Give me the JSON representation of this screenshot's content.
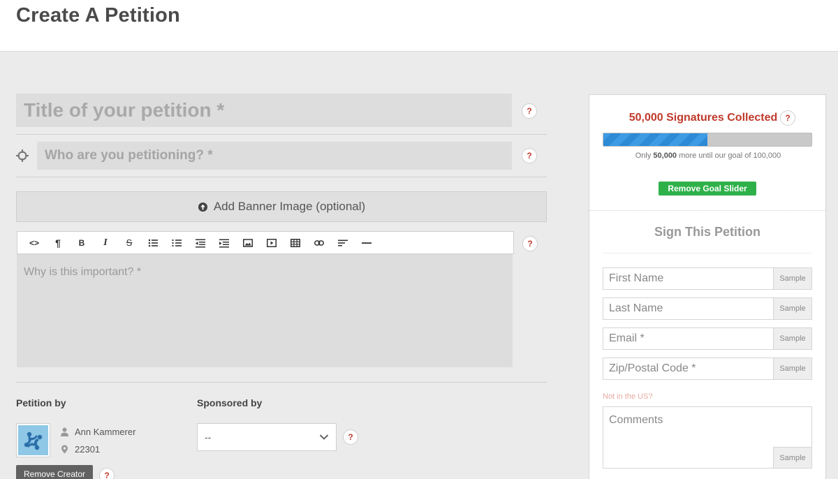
{
  "header": {
    "title": "Create A Petition"
  },
  "help_mark": "?",
  "petition": {
    "title_placeholder": "Title of your petition *",
    "target_placeholder": "Who are you petitioning? *",
    "banner_label": "Add Banner Image (optional)",
    "body_placeholder": "Why is this important? *"
  },
  "editor_toolbar": {
    "buttons": [
      {
        "name": "html-icon",
        "glyph": "<>"
      },
      {
        "name": "paragraph-icon",
        "glyph": "¶"
      },
      {
        "name": "bold-icon",
        "glyph": "B"
      },
      {
        "name": "italic-icon",
        "glyph": "I"
      },
      {
        "name": "strikethrough-icon",
        "glyph": "S"
      },
      {
        "name": "unordered-list-icon",
        "glyph": ""
      },
      {
        "name": "ordered-list-icon",
        "glyph": ""
      },
      {
        "name": "outdent-icon",
        "glyph": ""
      },
      {
        "name": "indent-icon",
        "glyph": ""
      },
      {
        "name": "image-icon",
        "glyph": ""
      },
      {
        "name": "video-icon",
        "glyph": ""
      },
      {
        "name": "table-icon",
        "glyph": ""
      },
      {
        "name": "link-icon",
        "glyph": ""
      },
      {
        "name": "align-left-icon",
        "glyph": ""
      },
      {
        "name": "horizontal-rule-icon",
        "glyph": ""
      }
    ]
  },
  "creator": {
    "label": "Petition by",
    "name": "Ann Kammerer",
    "zip": "22301",
    "remove_label": "Remove Creator"
  },
  "sponsor": {
    "label": "Sponsored by",
    "selected": "--"
  },
  "goal": {
    "collected_label": "50,000 Signatures Collected",
    "progress_fraction": 0.5,
    "note_prefix": "Only ",
    "note_count": "50,000",
    "note_suffix": " more until our goal of 100,000",
    "remove_label": "Remove Goal Slider"
  },
  "sign_form": {
    "title": "Sign This Petition",
    "sample_label": "Sample",
    "first_name_placeholder": "First Name",
    "last_name_placeholder": "Last Name",
    "email_placeholder": "Email *",
    "zip_placeholder": "Zip/Postal Code *",
    "not_us_link": "Not in the US?",
    "comments_placeholder": "Comments"
  },
  "colors": {
    "accent_red": "#c0392b",
    "progress_blue": "#2c8ad6",
    "button_green": "#2fb14a"
  }
}
